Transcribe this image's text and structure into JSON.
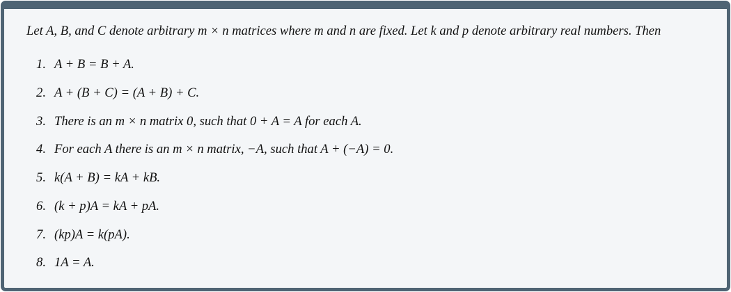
{
  "theorem": {
    "intro": "Let A, B, and C denote arbitrary m × n matrices where m and n are fixed. Let k and p denote arbitrary real numbers. Then",
    "items": [
      {
        "num": "1.",
        "text": "A + B = B + A."
      },
      {
        "num": "2.",
        "text": "A + (B + C) = (A + B) + C."
      },
      {
        "num": "3.",
        "text": "There is an m × n matrix 0, such that 0 + A = A for each A."
      },
      {
        "num": "4.",
        "text": "For each A there is an m × n matrix, −A, such that A + (−A) = 0."
      },
      {
        "num": "5.",
        "text": "k(A + B) = kA + kB."
      },
      {
        "num": "6.",
        "text": "(k + p)A = kA + pA."
      },
      {
        "num": "7.",
        "text": "(kp)A = k(pA)."
      },
      {
        "num": "8.",
        "text": "1A = A."
      }
    ]
  },
  "colors": {
    "frame": "#4f6474",
    "background": "#f4f6f8"
  }
}
